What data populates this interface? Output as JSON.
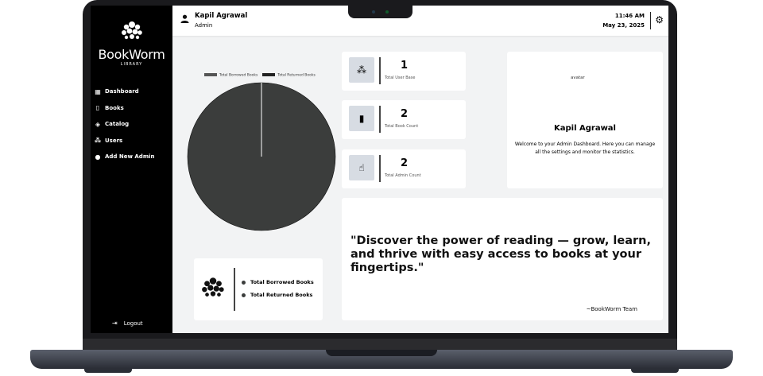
{
  "app": {
    "name": "BookWorm",
    "subtitle": "LIBRARY"
  },
  "sidebar": {
    "items": [
      {
        "label": "Dashboard",
        "icon": "dashboard-icon"
      },
      {
        "label": "Books",
        "icon": "book-icon"
      },
      {
        "label": "Catalog",
        "icon": "catalog-icon"
      },
      {
        "label": "Users",
        "icon": "users-icon"
      },
      {
        "label": "Add New Admin",
        "icon": "add-admin-icon"
      }
    ],
    "logout_label": "Logout"
  },
  "header": {
    "user_name": "Kapil Agrawal",
    "user_role": "Admin",
    "time": "11:46 AM",
    "date": "May 23, 2025"
  },
  "chart_data": {
    "type": "pie",
    "series": [
      {
        "name": "Total Borrowed Books",
        "value": 2
      },
      {
        "name": "Total Returned Books",
        "value": 0
      }
    ],
    "legend": [
      "Total Borrowed Books",
      "Total Returned Books"
    ],
    "legend_position": "top"
  },
  "stats": [
    {
      "value": "1",
      "label": "Total User Base",
      "icon": "users-icon"
    },
    {
      "value": "2",
      "label": "Total Book Count",
      "icon": "book-icon"
    },
    {
      "value": "2",
      "label": "Total Admin Count",
      "icon": "admin-icon"
    }
  ],
  "profile": {
    "avatar_alt": "avatar",
    "name": "Kapil Agrawal",
    "welcome": "Welcome to your Admin Dashboard. Here you can manage all the settings and monitor the statistics."
  },
  "quote": {
    "text": "\"Discover the power of reading — grow, learn, and thrive with easy access to books at your fingertips.\"",
    "author": "~BookWorm Team"
  },
  "legend_card": {
    "borrowed": "Total Borrowed Books",
    "returned": "Total Returned Books"
  },
  "colors": {
    "pie": "#3b3d3c",
    "sidebar": "#000000",
    "background": "#f2f3f4"
  }
}
